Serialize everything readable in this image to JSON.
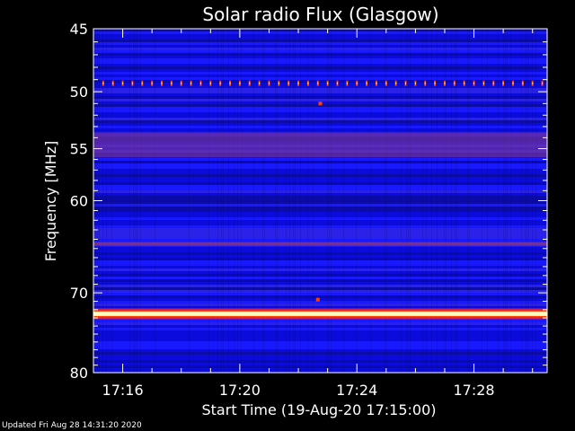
{
  "footer": {
    "updated": "Updated Fri Aug 28 14:31:20 2020"
  },
  "chart_data": {
    "type": "heatmap",
    "title": "Solar radio Flux (Glasgow)",
    "xlabel": "Start Time (19-Aug-20 17:15:00)",
    "ylabel": "Frequency [MHz]",
    "y_scale": "log",
    "xlim": [
      "17:15:00",
      "17:30:30"
    ],
    "ylim": [
      45,
      80
    ],
    "x_ticks": [
      "17:16",
      "17:20",
      "17:24",
      "17:28"
    ],
    "y_ticks": [
      45,
      50,
      55,
      60,
      70,
      80
    ],
    "colormap": [
      "#000060",
      "#0000c0",
      "#1a1aff",
      "#7030a0",
      "#c02060",
      "#ff4000",
      "#ffff80",
      "#ffffff"
    ],
    "background_color": "#000000",
    "features": [
      {
        "kind": "continuous_band",
        "frequency": 72.5,
        "intensity": "very-high"
      },
      {
        "kind": "continuous_band",
        "frequency": 64.5,
        "intensity": "medium"
      },
      {
        "kind": "periodic_bursts",
        "frequency": 49.3,
        "intensity": "high"
      },
      {
        "kind": "enhanced_band",
        "frequency_range": [
          53.5,
          55.8
        ],
        "intensity": "medium"
      },
      {
        "kind": "spot",
        "time": "17:22:45",
        "frequency": 51.0,
        "intensity": "high"
      },
      {
        "kind": "spot",
        "time": "17:22:40",
        "frequency": 70.8,
        "intensity": "high"
      }
    ]
  }
}
